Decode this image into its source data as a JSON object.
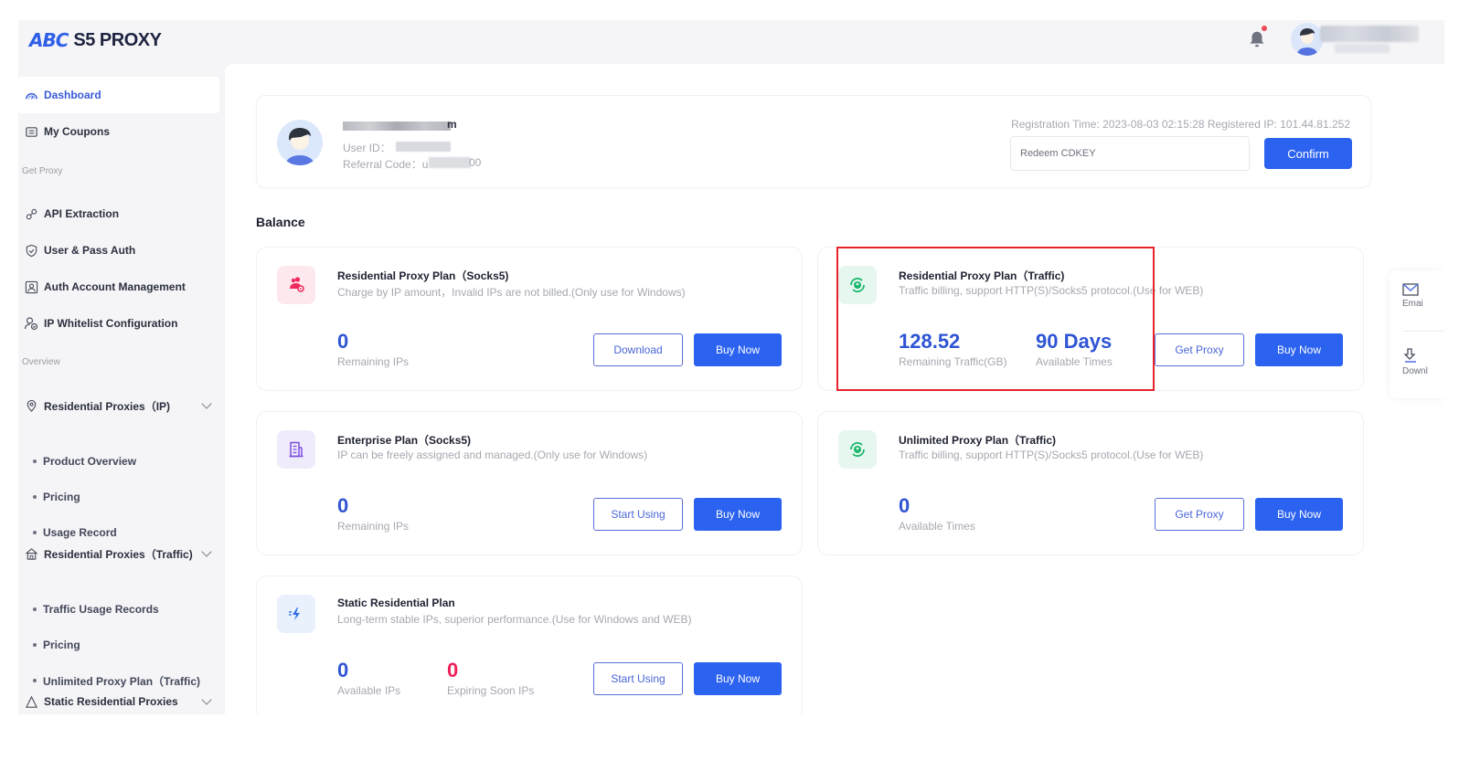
{
  "app": {
    "logo_mark": "ABC",
    "logo_text": "S5 PROXY"
  },
  "header": {
    "notification_icon": "bell-icon",
    "has_unread": true,
    "brand_color": "#2b63f0"
  },
  "sidebar": {
    "items": [
      {
        "label": "Dashboard",
        "icon": "dashboard-icon",
        "active": true
      },
      {
        "label": "My Coupons",
        "icon": "coupon-icon"
      }
    ],
    "sections": [
      {
        "title": "Get Proxy",
        "items": [
          {
            "label": "API Extraction",
            "icon": "link-icon"
          },
          {
            "label": "User & Pass Auth",
            "icon": "shield-icon"
          },
          {
            "label": "Auth Account Management",
            "icon": "account-card-icon"
          },
          {
            "label": "IP Whitelist Configuration",
            "icon": "user-check-icon"
          }
        ]
      },
      {
        "title": "Overview",
        "groups": [
          {
            "label": "Residential Proxies（IP)",
            "icon": "location-icon",
            "children": [
              "Product Overview",
              "Pricing",
              "Usage Record"
            ]
          },
          {
            "label": "Residential Proxies（Traffic)",
            "icon": "home-icon",
            "children": [
              "Traffic Usage Records",
              "Pricing",
              "Unlimited Proxy Plan（Traffic)"
            ]
          },
          {
            "label": "Static Residential Proxies",
            "icon": "static-icon",
            "children": []
          }
        ]
      }
    ]
  },
  "profile": {
    "username_suffix": "m",
    "user_id_label": "User ID：",
    "referral_label": "Referral Code：",
    "referral_prefix": "u",
    "referral_suffix": "00",
    "registration_info": "Registration Time: 2023-08-03 02:15:28  Registered IP:  101.44.81.252",
    "cdkey_placeholder": "Redeem CDKEY",
    "confirm_label": "Confirm"
  },
  "balance": {
    "title": "Balance",
    "cards": [
      {
        "title": "Residential Proxy Plan（Socks5)",
        "description": "Charge by IP amount，Invalid IPs are not billed.(Only use for Windows)",
        "icon": "users-gear-icon",
        "stats": [
          {
            "value": "0",
            "label": "Remaining IPs"
          }
        ],
        "secondary_button": "Download",
        "primary_button": "Buy Now"
      },
      {
        "title": "Residential Proxy Plan（Traffic)",
        "description": "Traffic billing, support HTTP(S)/Socks5 protocol.(Use for WEB)",
        "icon": "refresh-user-icon",
        "stats": [
          {
            "value": "128.52",
            "label": "Remaining Traffic(GB)"
          },
          {
            "value": "90 Days",
            "label": "Available Times"
          }
        ],
        "secondary_button": "Get Proxy",
        "primary_button": "Buy Now",
        "highlighted": true
      },
      {
        "title": "Enterprise Plan（Socks5)",
        "description": "IP can be freely assigned and managed.(Only use for Windows)",
        "icon": "building-icon",
        "stats": [
          {
            "value": "0",
            "label": "Remaining IPs"
          }
        ],
        "secondary_button": "Start Using",
        "primary_button": "Buy Now"
      },
      {
        "title": "Unlimited Proxy Plan（Traffic)",
        "description": "Traffic billing, support HTTP(S)/Socks5 protocol.(Use for WEB)",
        "icon": "refresh-user-icon",
        "stats": [
          {
            "value": "0",
            "label": "Available Times"
          }
        ],
        "secondary_button": "Get Proxy",
        "primary_button": "Buy Now"
      },
      {
        "title": "Static Residential Plan",
        "description": "Long-term stable IPs, superior performance.(Use for Windows and WEB)",
        "icon": "lightning-icon",
        "stats": [
          {
            "value": "0",
            "label": "Available IPs"
          },
          {
            "value": "0",
            "label": "Expiring Soon IPs"
          }
        ],
        "secondary_button": "Start Using",
        "primary_button": "Buy Now"
      }
    ]
  },
  "float_panel": {
    "items": [
      {
        "label": "Emai",
        "icon": "email-icon"
      },
      {
        "label": "Downl",
        "icon": "download-icon"
      }
    ]
  },
  "colors": {
    "primary": "#2b63f0",
    "stat_blue": "#2f55d4",
    "stat_red": "#ef1f58",
    "highlight_border": "#e8242a"
  }
}
